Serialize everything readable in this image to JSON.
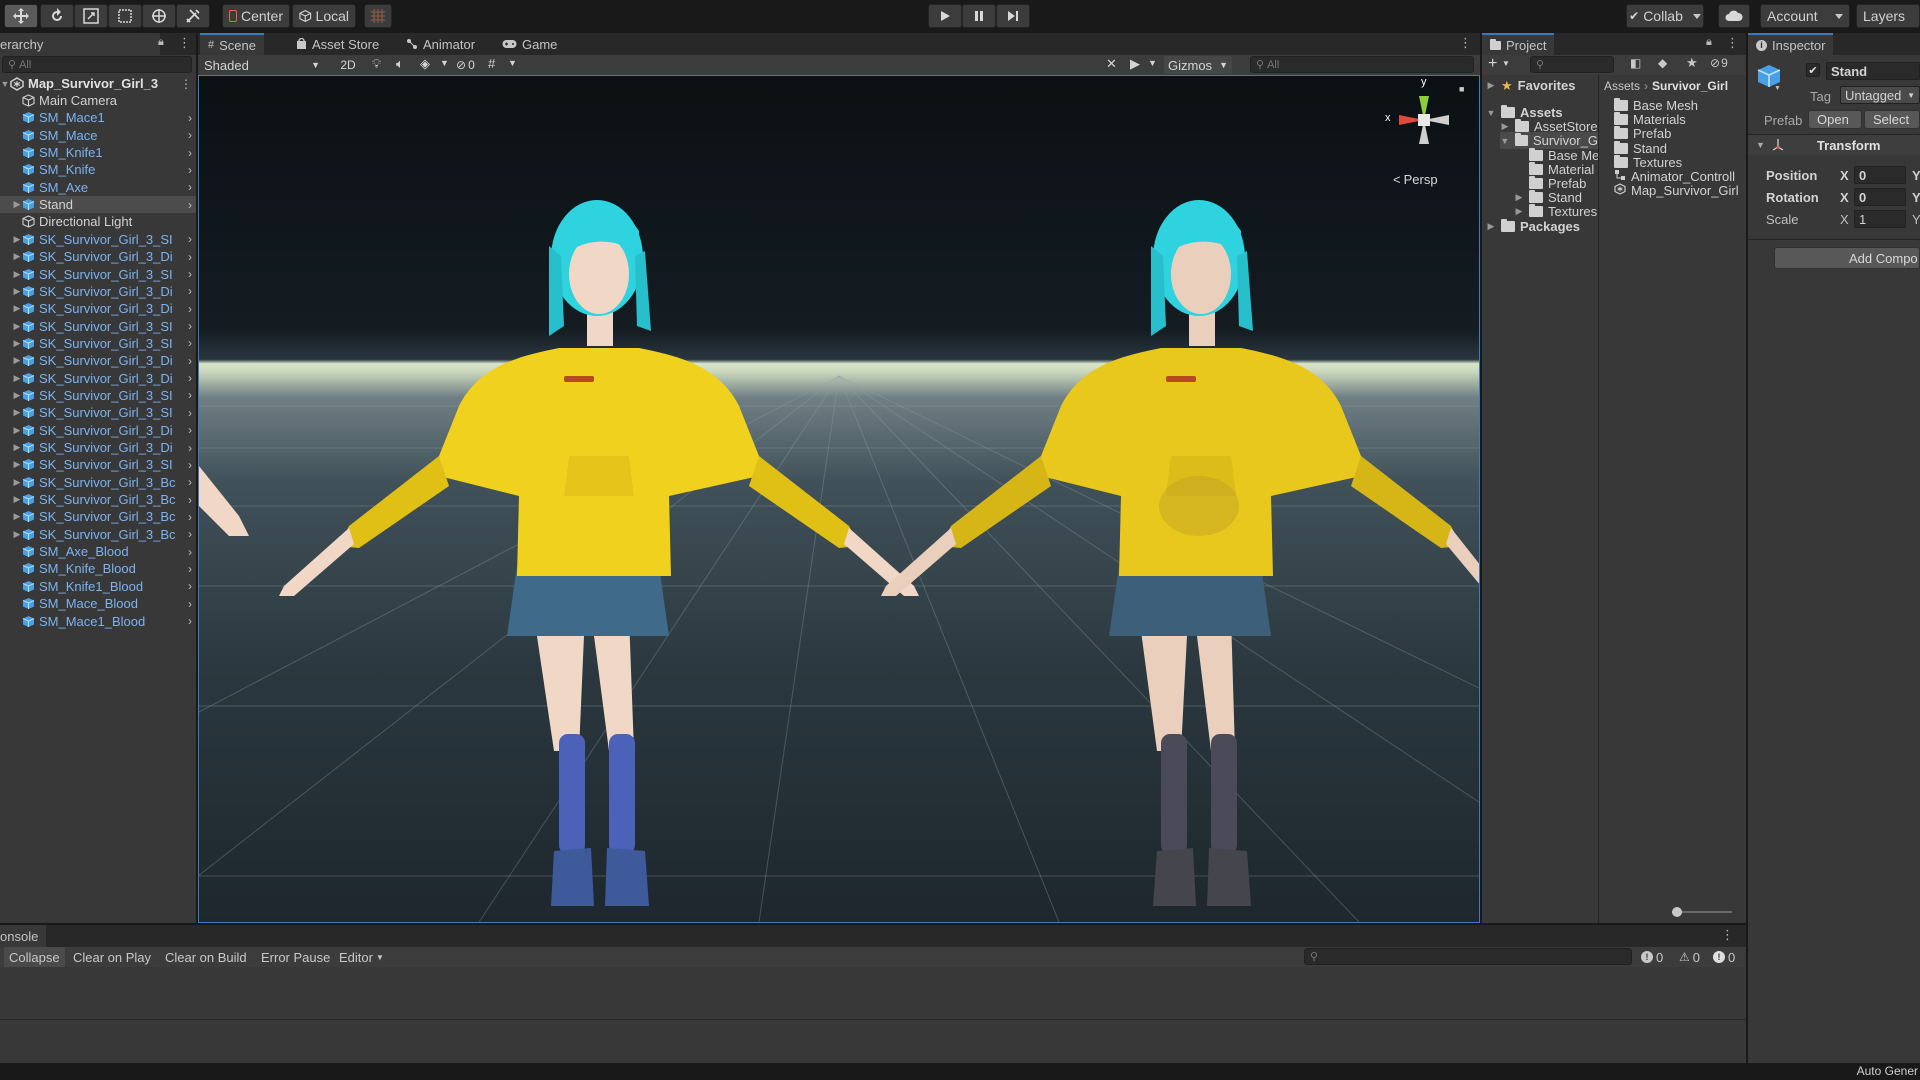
{
  "toolbar": {
    "pivot_label": "Center",
    "space_label": "Local",
    "collab_label": "Collab",
    "account_label": "Account",
    "layers_label": "Layers"
  },
  "hierarchy": {
    "tab_label": "erarchy",
    "search_placeholder": "All",
    "scene_name": "Map_Survivor_Girl_3",
    "items": [
      {
        "label": "Main Camera",
        "kind": "camera"
      },
      {
        "label": "SM_Mace1",
        "kind": "prefab"
      },
      {
        "label": "SM_Mace",
        "kind": "prefab"
      },
      {
        "label": "SM_Knife1",
        "kind": "prefab"
      },
      {
        "label": "SM_Knife",
        "kind": "prefab"
      },
      {
        "label": "SM_Axe",
        "kind": "prefab"
      },
      {
        "label": "Stand",
        "kind": "selected"
      },
      {
        "label": "Directional Light",
        "kind": "light"
      },
      {
        "label": "SK_Survivor_Girl_3_SI",
        "kind": "prefab"
      },
      {
        "label": "SK_Survivor_Girl_3_Di",
        "kind": "prefab"
      },
      {
        "label": "SK_Survivor_Girl_3_SI",
        "kind": "prefab"
      },
      {
        "label": "SK_Survivor_Girl_3_Di",
        "kind": "prefab"
      },
      {
        "label": "SK_Survivor_Girl_3_Di",
        "kind": "prefab"
      },
      {
        "label": "SK_Survivor_Girl_3_SI",
        "kind": "prefab"
      },
      {
        "label": "SK_Survivor_Girl_3_SI",
        "kind": "prefab"
      },
      {
        "label": "SK_Survivor_Girl_3_Di",
        "kind": "prefab"
      },
      {
        "label": "SK_Survivor_Girl_3_Di",
        "kind": "prefab"
      },
      {
        "label": "SK_Survivor_Girl_3_SI",
        "kind": "prefab"
      },
      {
        "label": "SK_Survivor_Girl_3_SI",
        "kind": "prefab"
      },
      {
        "label": "SK_Survivor_Girl_3_Di",
        "kind": "prefab"
      },
      {
        "label": "SK_Survivor_Girl_3_Di",
        "kind": "prefab"
      },
      {
        "label": "SK_Survivor_Girl_3_SI",
        "kind": "prefab"
      },
      {
        "label": "SK_Survivor_Girl_3_Bc",
        "kind": "prefab"
      },
      {
        "label": "SK_Survivor_Girl_3_Bc",
        "kind": "prefab"
      },
      {
        "label": "SK_Survivor_Girl_3_Bc",
        "kind": "prefab"
      },
      {
        "label": "SK_Survivor_Girl_3_Bc",
        "kind": "prefab"
      },
      {
        "label": "SM_Axe_Blood",
        "kind": "prefab"
      },
      {
        "label": "SM_Knife_Blood",
        "kind": "prefab"
      },
      {
        "label": "SM_Knife1_Blood",
        "kind": "prefab"
      },
      {
        "label": "SM_Mace_Blood",
        "kind": "prefab"
      },
      {
        "label": "SM_Mace1_Blood",
        "kind": "prefab"
      }
    ]
  },
  "scene_tabs": [
    {
      "label": "Scene",
      "icon": "scene-icon"
    },
    {
      "label": "Asset Store",
      "icon": "bag-icon"
    },
    {
      "label": "Animator",
      "icon": "animator-icon"
    },
    {
      "label": "Game",
      "icon": "gamepad-icon"
    }
  ],
  "scene_toolbar": {
    "shading_mode": "Shaded",
    "mode_2d": "2D",
    "hidden_count": "0",
    "gizmos_label": "Gizmos",
    "search_placeholder": "All",
    "projection_label": "Persp",
    "axis_x": "x",
    "axis_y": "y"
  },
  "project": {
    "tab_label": "Project",
    "hidden_count": "9",
    "tree": [
      {
        "label": "Favorites",
        "level": 0,
        "kind": "star",
        "bold": true,
        "arrow": "▶"
      },
      {
        "label": "Assets",
        "level": 0,
        "kind": "folder",
        "bold": true,
        "arrow": "▼"
      },
      {
        "label": "AssetStore",
        "level": 1,
        "kind": "folder",
        "bold": false,
        "arrow": "▶"
      },
      {
        "label": "Survivor_G",
        "level": 1,
        "kind": "folder",
        "bold": false,
        "arrow": "▼",
        "selected": true
      },
      {
        "label": "Base Me",
        "level": 2,
        "kind": "folder",
        "bold": false,
        "arrow": ""
      },
      {
        "label": "Material",
        "level": 2,
        "kind": "folder",
        "bold": false,
        "arrow": ""
      },
      {
        "label": "Prefab",
        "level": 2,
        "kind": "folder",
        "bold": false,
        "arrow": ""
      },
      {
        "label": "Stand",
        "level": 2,
        "kind": "folder",
        "bold": false,
        "arrow": "▶"
      },
      {
        "label": "Textures",
        "level": 2,
        "kind": "folder",
        "bold": false,
        "arrow": "▶"
      },
      {
        "label": "Packages",
        "level": 0,
        "kind": "folder",
        "bold": true,
        "arrow": "▶"
      }
    ],
    "breadcrumb_root": "Assets",
    "breadcrumb_current": "Survivor_Girl",
    "files": [
      {
        "label": "Base Mesh",
        "kind": "folder"
      },
      {
        "label": "Materials",
        "kind": "folder"
      },
      {
        "label": "Prefab",
        "kind": "folder"
      },
      {
        "label": "Stand",
        "kind": "folder"
      },
      {
        "label": "Textures",
        "kind": "folder"
      },
      {
        "label": "Animator_Controll",
        "kind": "animator"
      },
      {
        "label": "Map_Survivor_Girl",
        "kind": "scene"
      }
    ]
  },
  "inspector": {
    "tab_label": "Inspector",
    "object_name": "Stand",
    "tag_label": "Tag",
    "tag_value": "Untagged",
    "prefab_label": "Prefab",
    "open_label": "Open",
    "select_label": "Select",
    "transform_label": "Transform",
    "position_label": "Position",
    "rotation_label": "Rotation",
    "scale_label": "Scale",
    "x_label": "X",
    "y_label": "Y",
    "position_x": "0",
    "rotation_x": "0",
    "scale_x": "1",
    "add_component_label": "Add Compo"
  },
  "console": {
    "tab_label": "onsole",
    "collapse_label": "Collapse",
    "clear_on_play_label": "Clear on Play",
    "clear_on_build_label": "Clear on Build",
    "error_pause_label": "Error Pause",
    "editor_label": "Editor",
    "log_count": "0",
    "warning_count": "0",
    "error_count": "0"
  },
  "status_bar": {
    "text": "Auto Gener"
  },
  "colors": {
    "accent": "#3a79bb",
    "prefab_text": "#7cb3f0",
    "panel_bg": "#383838",
    "hoodie": "#f0d21e",
    "hair": "#2ed3df"
  }
}
